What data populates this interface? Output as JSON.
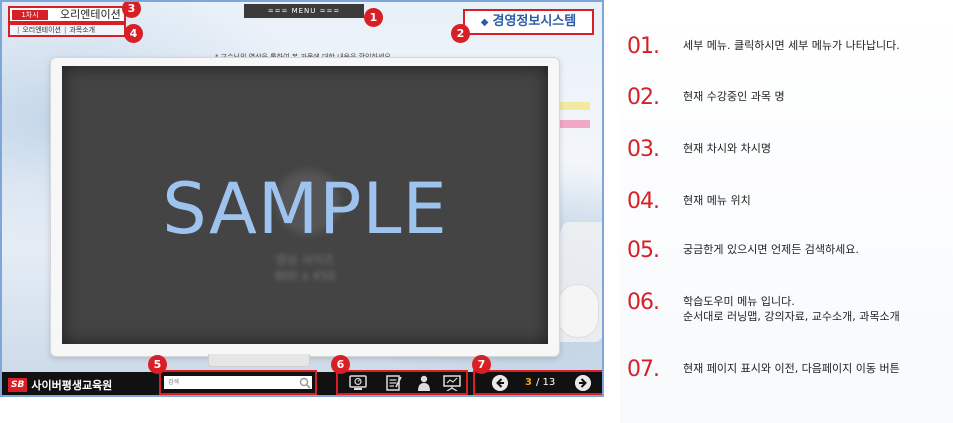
{
  "player": {
    "menu_label": "===  MENU  ===",
    "chapter_tag": "1차시",
    "chapter_title": "오리엔테이션",
    "location": [
      "오리엔테이션",
      "과목소개"
    ],
    "course_title": "경영정보시스템",
    "instruction": "* 교수님의 영상을 통하여 본 과목에 대한 내용을 확인하세요.",
    "video_placeholder": "SAMPLE",
    "video_hint_line1": "영상 사이즈",
    "video_hint_line2": "800 x 450",
    "logo_mark": "SB",
    "logo_text": "사이버평생교육원",
    "search_placeholder": "검색",
    "tools": [
      "monitor-icon",
      "notes-icon",
      "person-icon",
      "presentation-icon"
    ],
    "page_current": "3",
    "page_total": "/ 13",
    "badges": [
      "1",
      "2",
      "3",
      "4",
      "5",
      "6",
      "7"
    ]
  },
  "descriptions": [
    {
      "num": "01.",
      "text": "세부 메뉴. 클릭하시면 세부 메뉴가 나타납니다."
    },
    {
      "num": "02.",
      "text": "현재 수강중인 과목 명"
    },
    {
      "num": "03.",
      "text": "현재 차시와 차시명"
    },
    {
      "num": "04.",
      "text": "현재 메뉴 위치"
    },
    {
      "num": "05.",
      "text": "궁금한게 있으시면 언제든 검색하세요."
    },
    {
      "num": "06.",
      "text": "학습도우미 메뉴 입니다.",
      "text2": "순서대로 러닝맵, 강의자료, 교수소개, 과목소개"
    },
    {
      "num": "07.",
      "text": "현재 페이지 표시와 이전, 다음페이지 이동 버튼"
    }
  ],
  "colors": {
    "accent": "#d81f26",
    "course_blue": "#2b5ba7",
    "page_current": "#f0a020"
  }
}
